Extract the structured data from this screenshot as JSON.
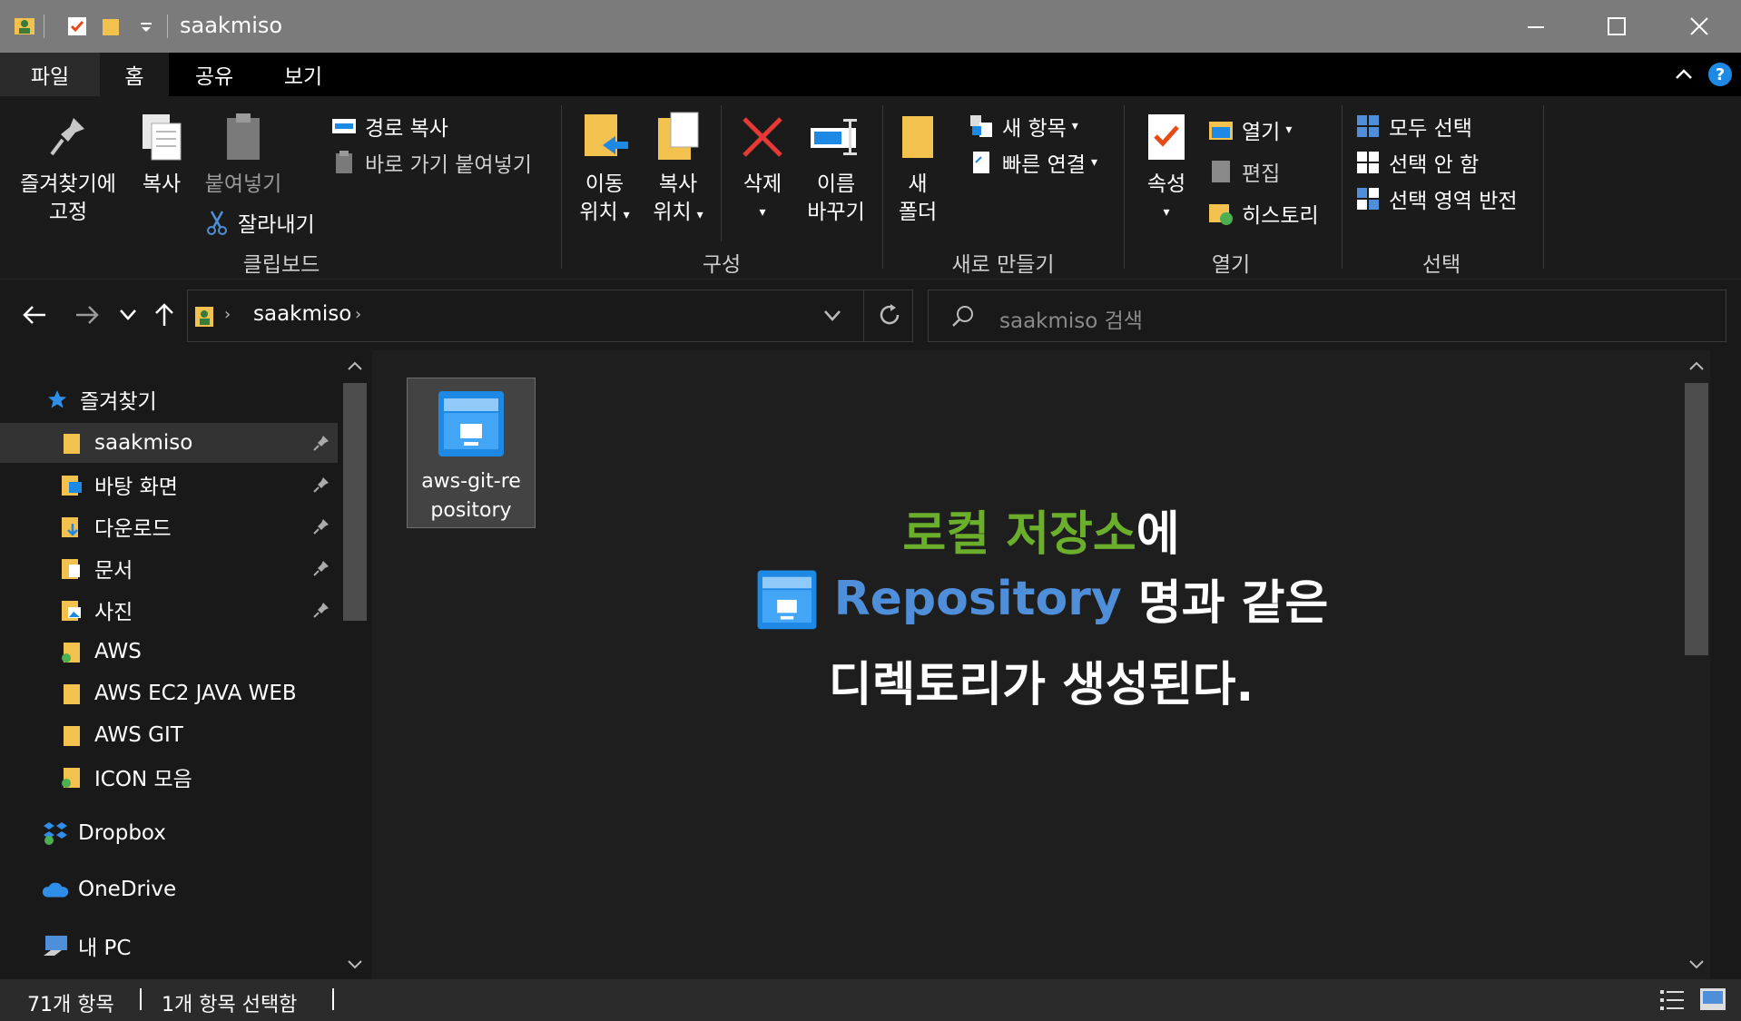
{
  "window": {
    "title": "saakmiso",
    "minimize_icon": "minimize-icon",
    "maximize_icon": "maximize-icon",
    "close_icon": "close-icon"
  },
  "ribbon_tabs": [
    "파일",
    "홈",
    "공유",
    "보기"
  ],
  "ribbon": {
    "clipboard": {
      "pin_label_1": "즐겨찾기에",
      "pin_label_2": "고정",
      "copy": "복사",
      "paste": "붙여넣기",
      "copy_path": "경로 복사",
      "paste_shortcut": "바로 가기 붙여넣기",
      "cut": "잘라내기",
      "group": "클립보드"
    },
    "organize": {
      "move_1": "이동",
      "move_2": "위치",
      "copy_1": "복사",
      "copy_2": "위치",
      "delete": "삭제",
      "rename_1": "이름",
      "rename_2": "바꾸기",
      "group": "구성"
    },
    "new": {
      "folder_1": "새",
      "folder_2": "폴더",
      "new_item": "새 항목",
      "easy_access": "빠른 연결",
      "group": "새로 만들기"
    },
    "open": {
      "properties": "속성",
      "open": "열기",
      "edit": "편집",
      "history": "히스토리",
      "group": "열기"
    },
    "select": {
      "select_all": "모두 선택",
      "select_none": "선택 안 함",
      "invert": "선택 영역 반전",
      "group": "선택"
    }
  },
  "address": {
    "path": "saakmiso",
    "search_placeholder": "saakmiso 검색"
  },
  "nav": {
    "quick_access": "즐겨찾기",
    "items": [
      {
        "label": "saakmiso",
        "pinned": true
      },
      {
        "label": "바탕 화면",
        "pinned": true
      },
      {
        "label": "다운로드",
        "pinned": true
      },
      {
        "label": "문서",
        "pinned": true
      },
      {
        "label": "사진",
        "pinned": true
      },
      {
        "label": "AWS",
        "pinned": false
      },
      {
        "label": "AWS EC2 JAVA WEB",
        "pinned": false
      },
      {
        "label": "AWS GIT",
        "pinned": false
      },
      {
        "label": "ICON 모음",
        "pinned": false
      }
    ],
    "dropbox": "Dropbox",
    "onedrive": "OneDrive",
    "this_pc": "내 PC"
  },
  "content": {
    "file_name_1": "aws-git-re",
    "file_name_2": "pository"
  },
  "overlay": {
    "line1_green": "로컬 저장소",
    "line1_white": "에",
    "line2_blue": "Repository",
    "line2_white": " 명과 같은",
    "line3": "디렉토리가 생성된다."
  },
  "status": {
    "count": "71개 항목",
    "selected": "1개 항목 선택함"
  },
  "colors": {
    "titlebar": "#7b7b7b",
    "background": "#191919",
    "accent_green": "#6aae2c",
    "accent_blue": "#4f8ed8",
    "folder_yellow": "#f2c14e",
    "repo_blue": "#1e88e5"
  }
}
